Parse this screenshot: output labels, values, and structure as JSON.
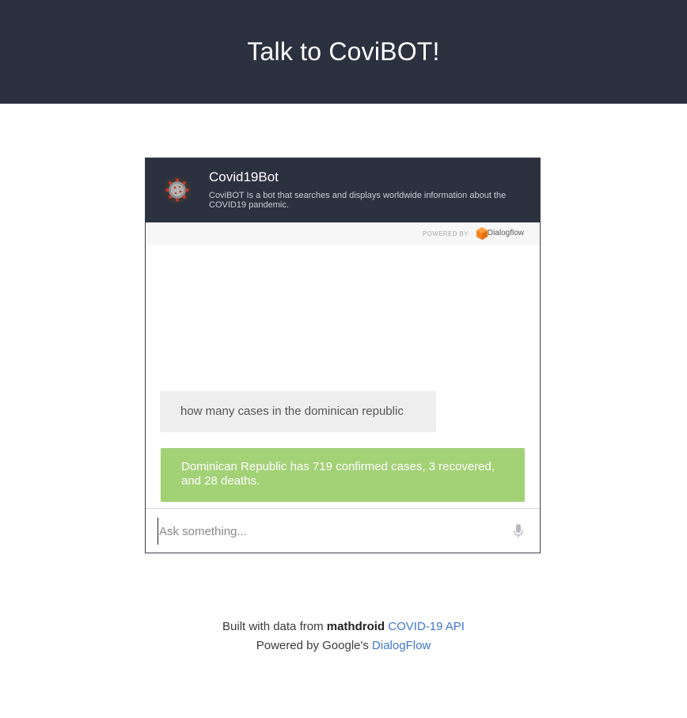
{
  "page": {
    "title": "Talk to CoviBOT!"
  },
  "bot": {
    "name": "Covid19Bot",
    "description": "CoviBOT Is a bot that searches and displays worldwide information about the COVID19 pandemic.",
    "avatar_icon": "coronavirus-icon"
  },
  "powered_bar": {
    "label": "POWERED BY",
    "brand": "Dialogflow",
    "brand_icon": "dialogflow-logo-icon",
    "brand_color": "#f5821f"
  },
  "messages": [
    {
      "role": "user",
      "text": "how many cases in the dominican republic"
    },
    {
      "role": "bot",
      "text": "Dominican Republic has 719 confirmed cases, 3 recovered, and 28 deaths."
    }
  ],
  "input": {
    "value": "",
    "placeholder": "Ask something...",
    "mic_icon": "microphone-icon"
  },
  "footer": {
    "line1_prefix": "Built with data from",
    "line1_bold": "mathdroid",
    "line1_link": "COVID-19 API",
    "line2_prefix": "Powered by Google's",
    "line2_link": "DialogFlow"
  },
  "colors": {
    "header_bg": "#2c3140",
    "bot_bubble": "#a3d176",
    "user_bubble": "#eeeeee",
    "link": "#3f77cf"
  }
}
